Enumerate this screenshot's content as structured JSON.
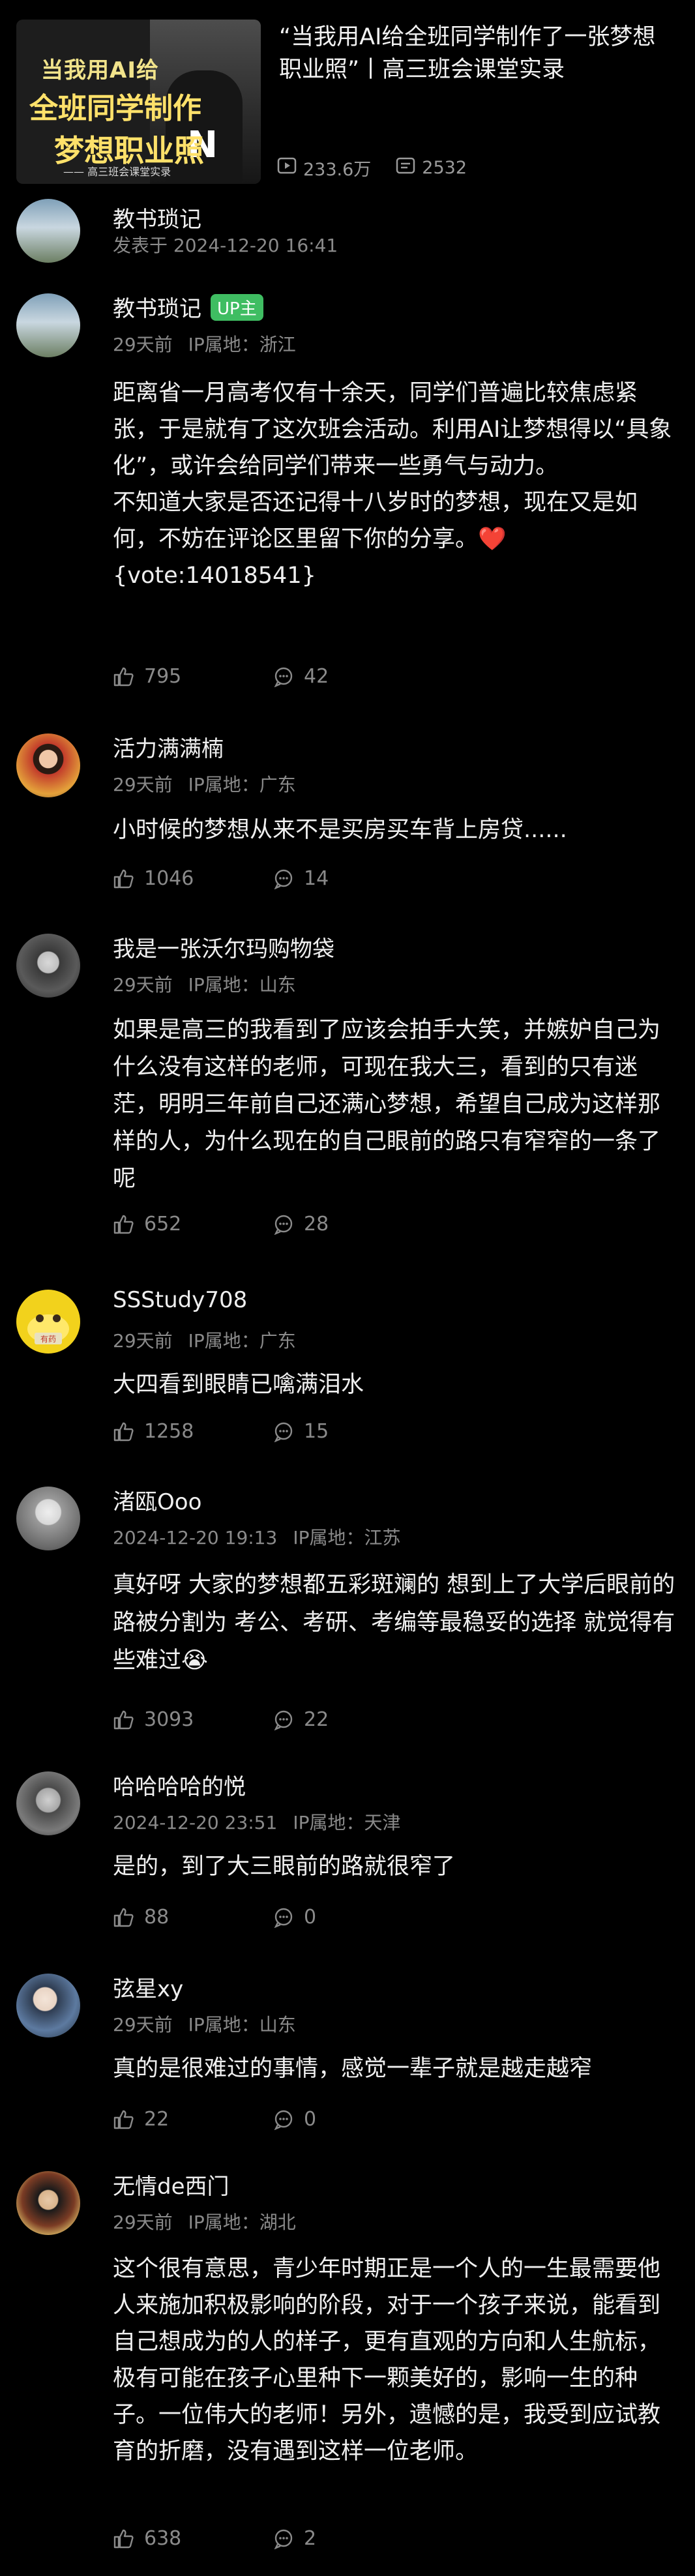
{
  "video": {
    "thumbnail": {
      "line1": "当我用AI给",
      "line2": "全班同学制作",
      "line3": "梦想职业照",
      "line4": "—— 高三班会课堂实录",
      "shirt_letter": "N"
    },
    "title": "“当我用AI给全班同学制作了一张梦想职业照”丨高三班会课堂实录",
    "views": "233.6万",
    "danmaku": "2532"
  },
  "poster": {
    "name": "教书琐记",
    "meta": "发表于 2024-12-20 16:41"
  },
  "comments": [
    {
      "name": "教书琐记",
      "badge": "UP主",
      "time": "29天前",
      "ip": "IP属地：浙江",
      "text": "距离省一月高考仅有十余天，同学们普遍比较焦虑紧张，于是就有了这次班会活动。利用AI让梦想得以“具象化”，或许会给同学们带来一些勇气与动力。\n不知道大家是否还记得十八岁时的梦想，现在又是如何，不妨在评论区里留下你的分享。",
      "heart": "❤️",
      "text2": "{vote:14018541}",
      "likes": "795",
      "replies": "42"
    },
    {
      "name": "活力满满楠",
      "time": "29天前",
      "ip": "IP属地：广东",
      "text": "小时候的梦想从来不是买房买车背上房贷......",
      "likes": "1046",
      "replies": "14"
    },
    {
      "name": "我是一张沃尔玛购物袋",
      "time": "29天前",
      "ip": "IP属地：山东",
      "text": "如果是高三的我看到了应该会拍手大笑，并嫉妒自己为什么没有这样的老师，可现在我大三，看到的只有迷茫，明明三年前自己还满心梦想，希望自己成为这样那样的人，为什么现在的自己眼前的路只有窄窄的一条了呢",
      "likes": "652",
      "replies": "28"
    },
    {
      "name": "SSStudy708",
      "time": "29天前",
      "ip": "IP属地：广东",
      "text": "大四看到眼睛已噙满泪水",
      "likes": "1258",
      "replies": "15"
    },
    {
      "name": "渚瓯Ooo",
      "time": "2024-12-20 19:13",
      "ip": "IP属地：江苏",
      "text": "真好呀 大家的梦想都五彩斑斓的 想到上了大学后眼前的路被分割为 考公、考研、考编等最稳妥的选择 就觉得有些难过😭",
      "likes": "3093",
      "replies": "22"
    },
    {
      "name": "哈哈哈哈的悦",
      "time": "2024-12-20 23:51",
      "ip": "IP属地：天津",
      "text": "是的，到了大三眼前的路就很窄了",
      "likes": "88",
      "replies": "0"
    },
    {
      "name": "弦星xy",
      "time": "29天前",
      "ip": "IP属地：山东",
      "text": "真的是很难过的事情，感觉一辈子就是越走越窄",
      "likes": "22",
      "replies": "0"
    },
    {
      "name": "无情de西门",
      "time": "29天前",
      "ip": "IP属地：湖北",
      "text": "这个很有意思，青少年时期正是一个人的一生最需要他人来施加积极影响的阶段，对于一个孩子来说，能看到自己想成为的人的样子，更有直观的方向和人生航标，极有可能在孩子心里种下一颗美好的，影响一生的种子。一位伟大的老师！另外，遗憾的是，我受到应试教育的折磨，没有遇到这样一位老师。",
      "likes": "638",
      "replies": "2"
    }
  ],
  "avatar_badge_text": "有药"
}
